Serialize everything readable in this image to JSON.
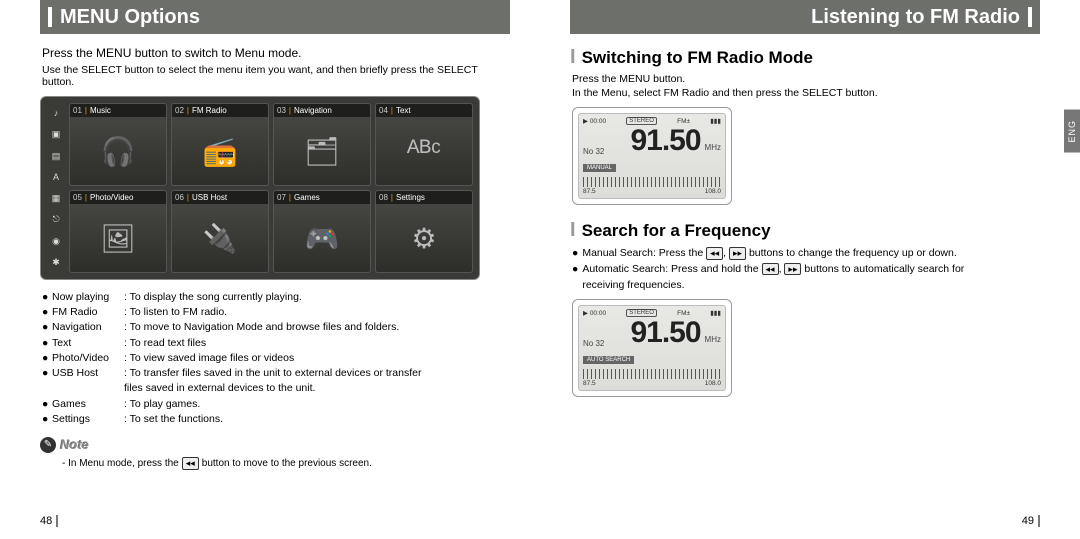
{
  "left": {
    "header": "MENU Options",
    "intro": "Press the MENU button to switch to Menu mode.",
    "sub": "Use the SELECT button to select the menu item you want, and then briefly press the SELECT button.",
    "tiles": [
      {
        "num": "01",
        "label": "Music"
      },
      {
        "num": "02",
        "label": "FM Radio"
      },
      {
        "num": "03",
        "label": "Navigation"
      },
      {
        "num": "04",
        "label": "Text"
      },
      {
        "num": "05",
        "label": "Photo/Video"
      },
      {
        "num": "06",
        "label": "USB Host"
      },
      {
        "num": "07",
        "label": "Games"
      },
      {
        "num": "08",
        "label": "Settings"
      }
    ],
    "defs": [
      {
        "term": "Now playing",
        "desc": ": To display the song currently playing."
      },
      {
        "term": "FM Radio",
        "desc": ": To listen to FM radio."
      },
      {
        "term": "Navigation",
        "desc": ": To move to Navigation Mode and browse files and folders."
      },
      {
        "term": "Text",
        "desc": ": To read text files"
      },
      {
        "term": "Photo/Video",
        "desc": ": To view saved image files or videos"
      },
      {
        "term": "USB Host",
        "desc": ": To transfer files saved in the unit to external devices or transfer",
        "cont": "files saved in external devices to the unit."
      },
      {
        "term": "Games",
        "desc": ": To play games."
      },
      {
        "term": "Settings",
        "desc": ": To set the functions."
      }
    ],
    "note_label": "Note",
    "note_text_a": "- In Menu mode, press the",
    "note_text_b": "button to move to the previous screen.",
    "pagenum": "48"
  },
  "right": {
    "header": "Listening to FM Radio",
    "lang_tab": "ENG",
    "sect1": {
      "title": "Switching to FM Radio Mode",
      "line1": "Press the MENU button.",
      "line2": "In the Menu, select FM Radio and then press the SELECT button."
    },
    "radio1": {
      "time": "00:00",
      "stereo": "STEREO",
      "band": "FM±",
      "ch": "No\n32",
      "freq": "91.50",
      "unit": "MHz",
      "mode": "MANUAL",
      "lo": "87.5",
      "hi": "108.0"
    },
    "sect2": {
      "title": "Search for a Frequency",
      "b1a": "Manual Search: Press the",
      "b1b": "buttons to change the frequency up or down.",
      "b2a": "Automatic Search: Press and hold the",
      "b2b": "buttons to automatically search for",
      "b2c": "receiving frequencies."
    },
    "radio2": {
      "time": "00:00",
      "stereo": "STEREO",
      "band": "FM±",
      "ch": "No\n32",
      "freq": "91.50",
      "unit": "MHz",
      "mode": "AUTO SEARCH",
      "lo": "87.5",
      "hi": "108.0"
    },
    "pagenum": "49"
  },
  "icons": {
    "rew": "◂◂",
    "fwd": "▸▸",
    "tile_glyphs": [
      "🎧",
      "📻",
      "🗂",
      "ᴬᴮᶜ",
      "🖼",
      "🔌",
      "🎮",
      "⚙"
    ]
  }
}
